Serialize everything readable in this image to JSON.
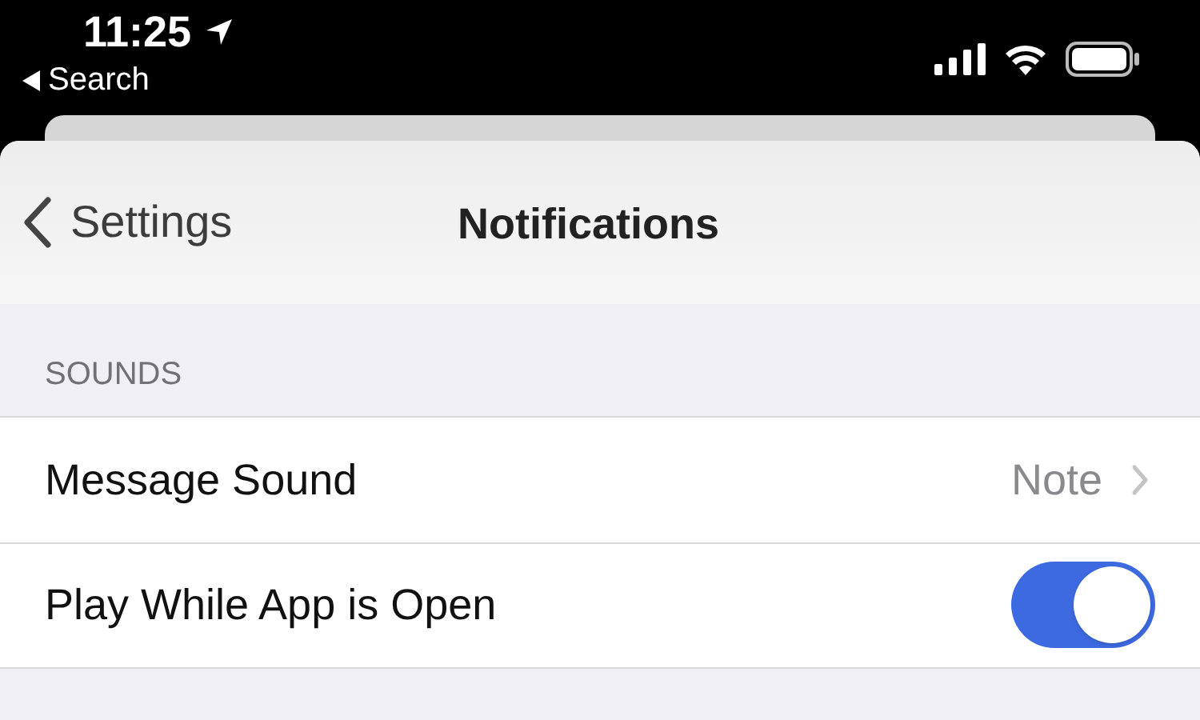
{
  "status_bar": {
    "time": "11:25",
    "back_label": "Search"
  },
  "nav": {
    "back": "Settings",
    "title": "Notifications"
  },
  "sections": [
    {
      "header": "SOUNDS",
      "rows": [
        {
          "kind": "disclosure",
          "label": "Message Sound",
          "value": "Note"
        },
        {
          "kind": "toggle",
          "label": "Play While App is Open",
          "on": true
        }
      ]
    }
  ]
}
